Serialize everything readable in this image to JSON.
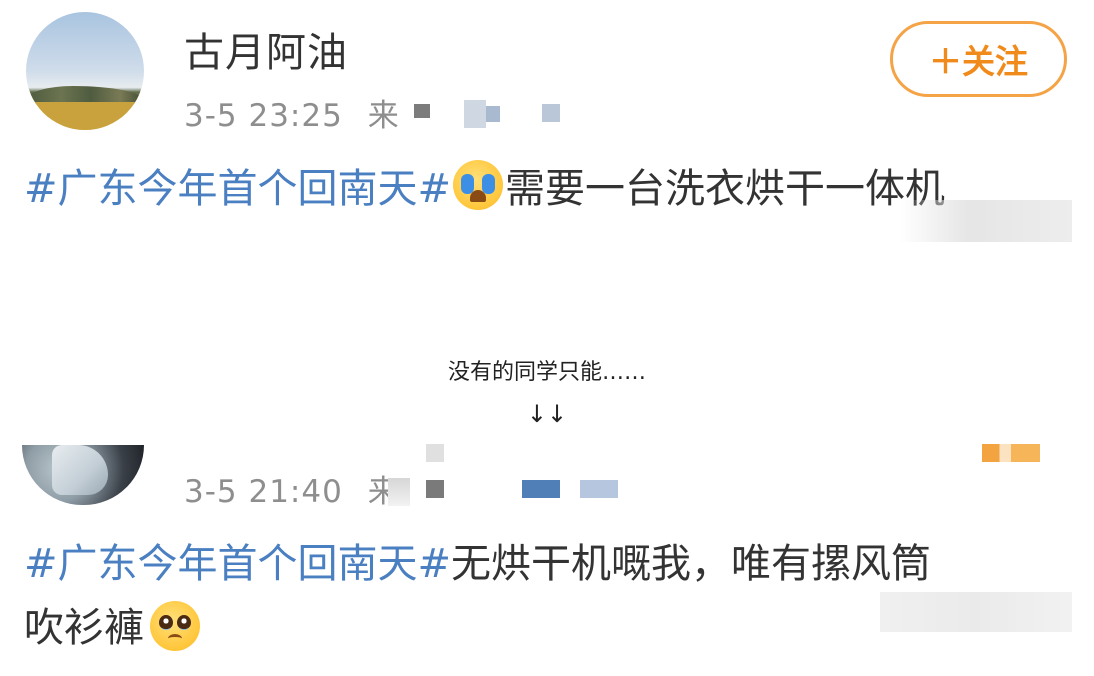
{
  "posts": [
    {
      "username": "古月阿油",
      "follow_label": "＋关注",
      "timestamp": "3-5 23:25",
      "source_prefix": "来",
      "hashtag": "#广东今年首个回南天#",
      "emoji": "crying-face",
      "body": "需要一台洗衣烘干一体机"
    },
    {
      "timestamp": "3-5 21:40",
      "source_prefix": "来",
      "hashtag": "#广东今年首个回南天#",
      "body_line1": "无烘干机嘅我，唯有摞风筒",
      "body_line2": "吹衫褲",
      "emoji": "pleading-face"
    }
  ],
  "caption": {
    "text": "没有的同学只能……",
    "arrows": "↓↓"
  },
  "colors": {
    "hashtag": "#4a7fc1",
    "follow_accent": "#f08a1a",
    "text": "#333333",
    "meta": "#8e8e8e"
  }
}
